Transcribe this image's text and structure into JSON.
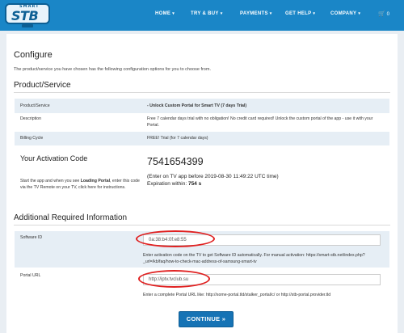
{
  "brand": {
    "small": "SMART",
    "name": "STB"
  },
  "nav": [
    {
      "label": "HOME"
    },
    {
      "label": "TRY & BUY"
    },
    {
      "label": "PAYMENTS"
    },
    {
      "label": "GET HELP"
    },
    {
      "label": "COMPANY"
    }
  ],
  "cart_count": "0",
  "page": {
    "title": "Configure",
    "subtitle": "The product/service you have chosen has the following configuration options for you to choose from."
  },
  "product": {
    "heading": "Product/Service",
    "rows": [
      {
        "label": "Product/Service",
        "value": "- Unlock Custom Portal for Smart TV (7 days Trial)"
      },
      {
        "label": "Description",
        "value": "Free 7 calendar days trial with no obligation! No credit card required! Unlock the custom portal of the app - use it with your Portal."
      },
      {
        "label": "Billing Cycle",
        "value": "FREE! Trial (for 7 calendar days)"
      }
    ]
  },
  "activation": {
    "title": "Your Activation Code",
    "desc_pre": "Start the app and when you see ",
    "desc_bold": "Loading Portal",
    "desc_post": ", enter this code via the TV Remote on your TV, click here for instructions.",
    "code": "7541654399",
    "enter_before": "(Enter on TV app before 2019-08-30 11:49:22 UTC time)",
    "expiration_label": "Expiration within: ",
    "expiration_value": "754 s"
  },
  "additional": {
    "heading": "Additional Required Information",
    "software_id": {
      "label": "Software ID",
      "value": "0a:38:b4:0f:e8:55",
      "help": "Enter activation code on the TV to get Software ID automatically. For manual activation: https://smart-stb.net/index.php?_url=/kb/faq/how-to-check-mac-address-of-samsung-smart-tv"
    },
    "portal_url": {
      "label": "Portal URL",
      "value": "http://iptv.tvclub.su",
      "help": "Enter a complete Portal URL like: http://some-portal.tld/stalker_portal/c/ or http://stb-portal.provider.tld"
    }
  },
  "continue_label": "CONTINUE",
  "continue_arrow": "»",
  "colors": {
    "nav": "#1a86c7",
    "button": "#1673b5",
    "highlight": "#e02020"
  }
}
